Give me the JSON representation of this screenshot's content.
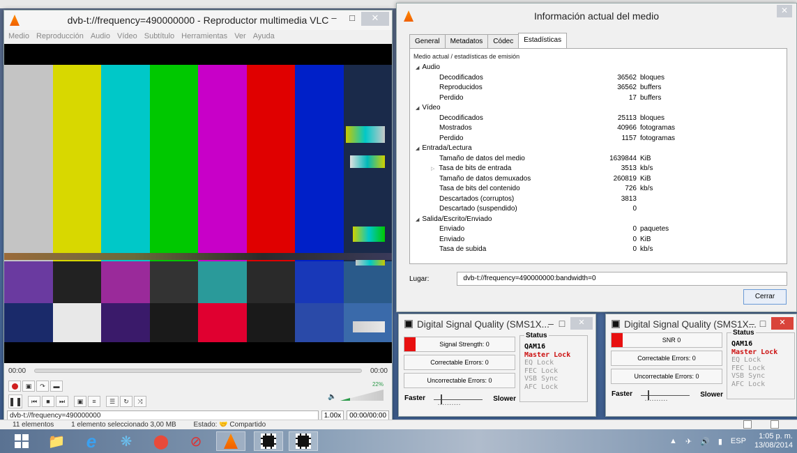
{
  "explorer": {
    "status": [
      "11 elementos",
      "1 elemento seleccionado  3,00 MB",
      "Estado: 🤝 Compartido"
    ]
  },
  "vlc": {
    "title": "dvb-t://frequency=490000000 - Reproductor multimedia VLC",
    "menu": [
      "Medio",
      "Reproducción",
      "Audio",
      "Vídeo",
      "Subtítulo",
      "Herramientas",
      "Ver",
      "Ayuda"
    ],
    "time_elapsed": "00:00",
    "time_total": "00:00",
    "volume": "22%",
    "media_path": "dvb-t://frequency=490000000",
    "speed": "1.00x",
    "time_display": "00:00/00:00"
  },
  "info": {
    "title": "Información actual del medio",
    "tabs": [
      "General",
      "Metadatos",
      "Códec",
      "Estadísticas"
    ],
    "panel_header": "Medio actual / estadísticas de emisión",
    "groups": [
      {
        "name": "Audio",
        "rows": [
          {
            "label": "Decodificados",
            "value": "36562",
            "unit": "bloques"
          },
          {
            "label": "Reproducidos",
            "value": "36562",
            "unit": "buffers"
          },
          {
            "label": "Perdido",
            "value": "17",
            "unit": "buffers"
          }
        ]
      },
      {
        "name": "Vídeo",
        "rows": [
          {
            "label": "Decodificados",
            "value": "25113",
            "unit": "bloques"
          },
          {
            "label": "Mostrados",
            "value": "40966",
            "unit": "fotogramas"
          },
          {
            "label": "Perdido",
            "value": "1157",
            "unit": "fotogramas"
          }
        ]
      },
      {
        "name": "Entrada/Lectura",
        "rows": [
          {
            "label": "Tamaño de datos del medio",
            "value": "1639844",
            "unit": "KiB"
          },
          {
            "label": "Tasa de bits de entrada",
            "value": "3513",
            "unit": "kb/s",
            "expandable": true
          },
          {
            "label": "Tamaño de datos demuxados",
            "value": "260819",
            "unit": "KiB"
          },
          {
            "label": "Tasa de bits del contenido",
            "value": "726",
            "unit": "kb/s"
          },
          {
            "label": "Descartados (corruptos)",
            "value": "3813",
            "unit": ""
          },
          {
            "label": "Descartado (suspendido)",
            "value": "0",
            "unit": ""
          }
        ]
      },
      {
        "name": "Salida/Escrito/Enviado",
        "rows": [
          {
            "label": "Enviado",
            "value": "0",
            "unit": "paquetes"
          },
          {
            "label": "Enviado",
            "value": "0",
            "unit": "KiB"
          },
          {
            "label": "Tasa de subida",
            "value": "0",
            "unit": "kb/s"
          }
        ]
      }
    ],
    "lugar_label": "Lugar:",
    "lugar_value": "dvb-t://frequency=490000000:bandwidth=0",
    "close_label": "Cerrar"
  },
  "sq1": {
    "title": "Digital Signal Quality (SMS1X...",
    "box1": "Signal Strength: 0",
    "box2": "Correctable Errors:  0",
    "box3": "Uncorrectable Errors:  0",
    "status_legend": "Status",
    "status": [
      "QAM16",
      "Master Lock",
      "EQ Lock",
      "FEC Lock",
      "VSB Sync",
      "AFC Lock"
    ],
    "faster": "Faster",
    "slower": "Slower"
  },
  "sq2": {
    "title": "Digital Signal Quality (SMS1X...",
    "box1": "SNR 0",
    "box2": "Correctable Errors:  0",
    "box3": "Uncorrectable Errors:  0",
    "status_legend": "Status",
    "status": [
      "QAM16",
      "Master Lock",
      "EQ Lock",
      "FEC Lock",
      "VSB Sync",
      "AFC Lock"
    ],
    "faster": "Faster",
    "slower": "Slower"
  },
  "taskbar": {
    "language": "ESP",
    "time": "1:05 p. m.",
    "date": "13/08/2014"
  }
}
